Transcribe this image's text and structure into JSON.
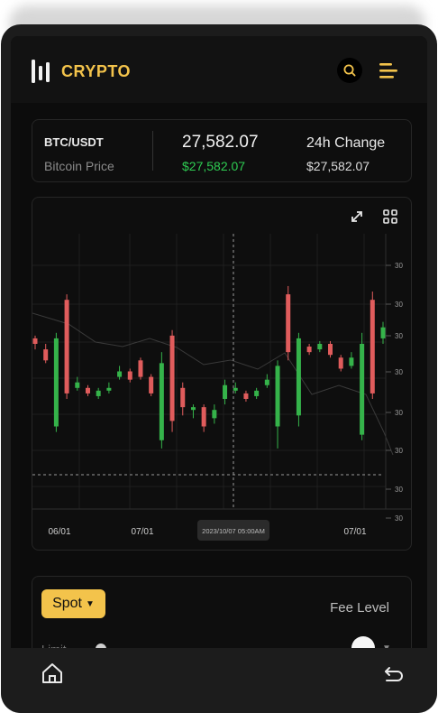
{
  "app": {
    "brand": "CRYPTO",
    "accent": "#f3c34b"
  },
  "header": {
    "icons": [
      "logo-icon",
      "search-icon",
      "menu-icon"
    ]
  },
  "ticker": {
    "pair": "BTC/USDT",
    "subtitle": "Bitcoin Price",
    "price": "27,582.07",
    "price_usd": "$27,582.07",
    "change_label": "24h Change",
    "change_value": "$27,582.07",
    "colors": {
      "up": "#2ecc52"
    }
  },
  "chart": {
    "toolbar_icons": [
      "expand-icon",
      "grid-icon"
    ],
    "y_tick_labels": [
      "30",
      "30",
      "30",
      "30",
      "30",
      "30",
      "30",
      "30"
    ],
    "x_tick_labels": [
      "06/01",
      "07/01",
      "07/01"
    ],
    "crosshair_label": "2023/10/07 05:00AM"
  },
  "chart_data": {
    "type": "candlestick",
    "up_color": "#35b34a",
    "down_color": "#e05c5c",
    "candles": [
      {
        "o": 0.62,
        "c": 0.6,
        "h": 0.63,
        "l": 0.58
      },
      {
        "o": 0.58,
        "c": 0.54,
        "h": 0.6,
        "l": 0.53
      },
      {
        "o": 0.3,
        "c": 0.62,
        "h": 0.64,
        "l": 0.28
      },
      {
        "o": 0.76,
        "c": 0.42,
        "h": 0.78,
        "l": 0.4
      },
      {
        "o": 0.44,
        "c": 0.46,
        "h": 0.48,
        "l": 0.43
      },
      {
        "o": 0.44,
        "c": 0.42,
        "h": 0.45,
        "l": 0.41
      },
      {
        "o": 0.41,
        "c": 0.43,
        "h": 0.44,
        "l": 0.4
      },
      {
        "o": 0.43,
        "c": 0.44,
        "h": 0.46,
        "l": 0.42
      },
      {
        "o": 0.48,
        "c": 0.5,
        "h": 0.52,
        "l": 0.47
      },
      {
        "o": 0.5,
        "c": 0.47,
        "h": 0.51,
        "l": 0.46
      },
      {
        "o": 0.54,
        "c": 0.48,
        "h": 0.55,
        "l": 0.47
      },
      {
        "o": 0.48,
        "c": 0.42,
        "h": 0.49,
        "l": 0.41
      },
      {
        "o": 0.25,
        "c": 0.53,
        "h": 0.57,
        "l": 0.22
      },
      {
        "o": 0.63,
        "c": 0.32,
        "h": 0.65,
        "l": 0.28
      },
      {
        "o": 0.44,
        "c": 0.37,
        "h": 0.46,
        "l": 0.34
      },
      {
        "o": 0.36,
        "c": 0.37,
        "h": 0.38,
        "l": 0.33
      },
      {
        "o": 0.37,
        "c": 0.3,
        "h": 0.38,
        "l": 0.28
      },
      {
        "o": 0.33,
        "c": 0.36,
        "h": 0.38,
        "l": 0.31
      },
      {
        "o": 0.4,
        "c": 0.45,
        "h": 0.47,
        "l": 0.38
      },
      {
        "o": 0.43,
        "c": 0.44,
        "h": 0.46,
        "l": 0.42
      },
      {
        "o": 0.42,
        "c": 0.4,
        "h": 0.43,
        "l": 0.39
      },
      {
        "o": 0.41,
        "c": 0.43,
        "h": 0.44,
        "l": 0.4
      },
      {
        "o": 0.45,
        "c": 0.47,
        "h": 0.49,
        "l": 0.44
      },
      {
        "o": 0.3,
        "c": 0.52,
        "h": 0.54,
        "l": 0.22
      },
      {
        "o": 0.78,
        "c": 0.57,
        "h": 0.81,
        "l": 0.54
      },
      {
        "o": 0.34,
        "c": 0.62,
        "h": 0.64,
        "l": 0.3
      },
      {
        "o": 0.59,
        "c": 0.57,
        "h": 0.6,
        "l": 0.56
      },
      {
        "o": 0.58,
        "c": 0.6,
        "h": 0.61,
        "l": 0.57
      },
      {
        "o": 0.6,
        "c": 0.56,
        "h": 0.61,
        "l": 0.55
      },
      {
        "o": 0.55,
        "c": 0.51,
        "h": 0.56,
        "l": 0.5
      },
      {
        "o": 0.52,
        "c": 0.55,
        "h": 0.57,
        "l": 0.51
      },
      {
        "o": 0.27,
        "c": 0.6,
        "h": 0.64,
        "l": 0.25
      },
      {
        "o": 0.76,
        "c": 0.42,
        "h": 0.79,
        "l": 0.4
      },
      {
        "o": 0.62,
        "c": 0.66,
        "h": 0.68,
        "l": 0.6
      }
    ]
  },
  "order_panel": {
    "type_label": "Spot",
    "fee_label": "Fee Level",
    "order_type": "Limit"
  },
  "navbar": {
    "icons": [
      "home-icon",
      "back-icon"
    ]
  }
}
